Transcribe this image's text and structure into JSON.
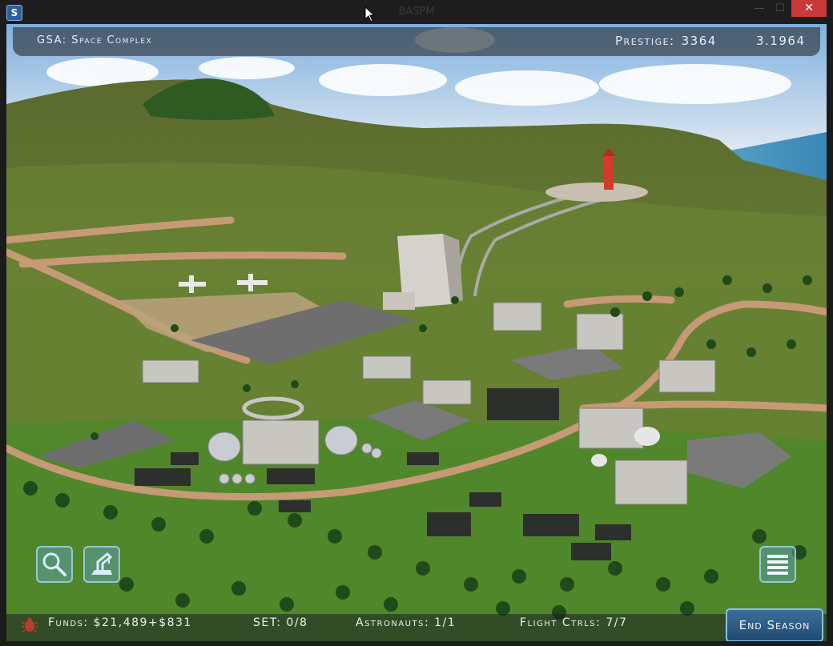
{
  "window": {
    "title": "BASPM",
    "minimize_glyph": "—",
    "maximize_glyph": "☐",
    "close_glyph": "✕"
  },
  "hud": {
    "location": "GSA: Space Complex",
    "prestige_label": "Prestige:",
    "prestige_value": "3364",
    "date": "3.1964"
  },
  "status": {
    "funds": "Funds: $21,489+$831",
    "set": "SET: 0/8",
    "astronauts": "Astronauts: 1/1",
    "flight_controllers": "Flight Ctrls: 7/7",
    "end_season_label": "End Season"
  },
  "tools": {
    "search": "search-icon",
    "construction": "crane-icon",
    "menu": "list-icon",
    "alert": "bug-icon"
  },
  "colors": {
    "hud_bg": "#37414b",
    "button_accent": "#3b6f99",
    "close_red": "#c7393a"
  }
}
